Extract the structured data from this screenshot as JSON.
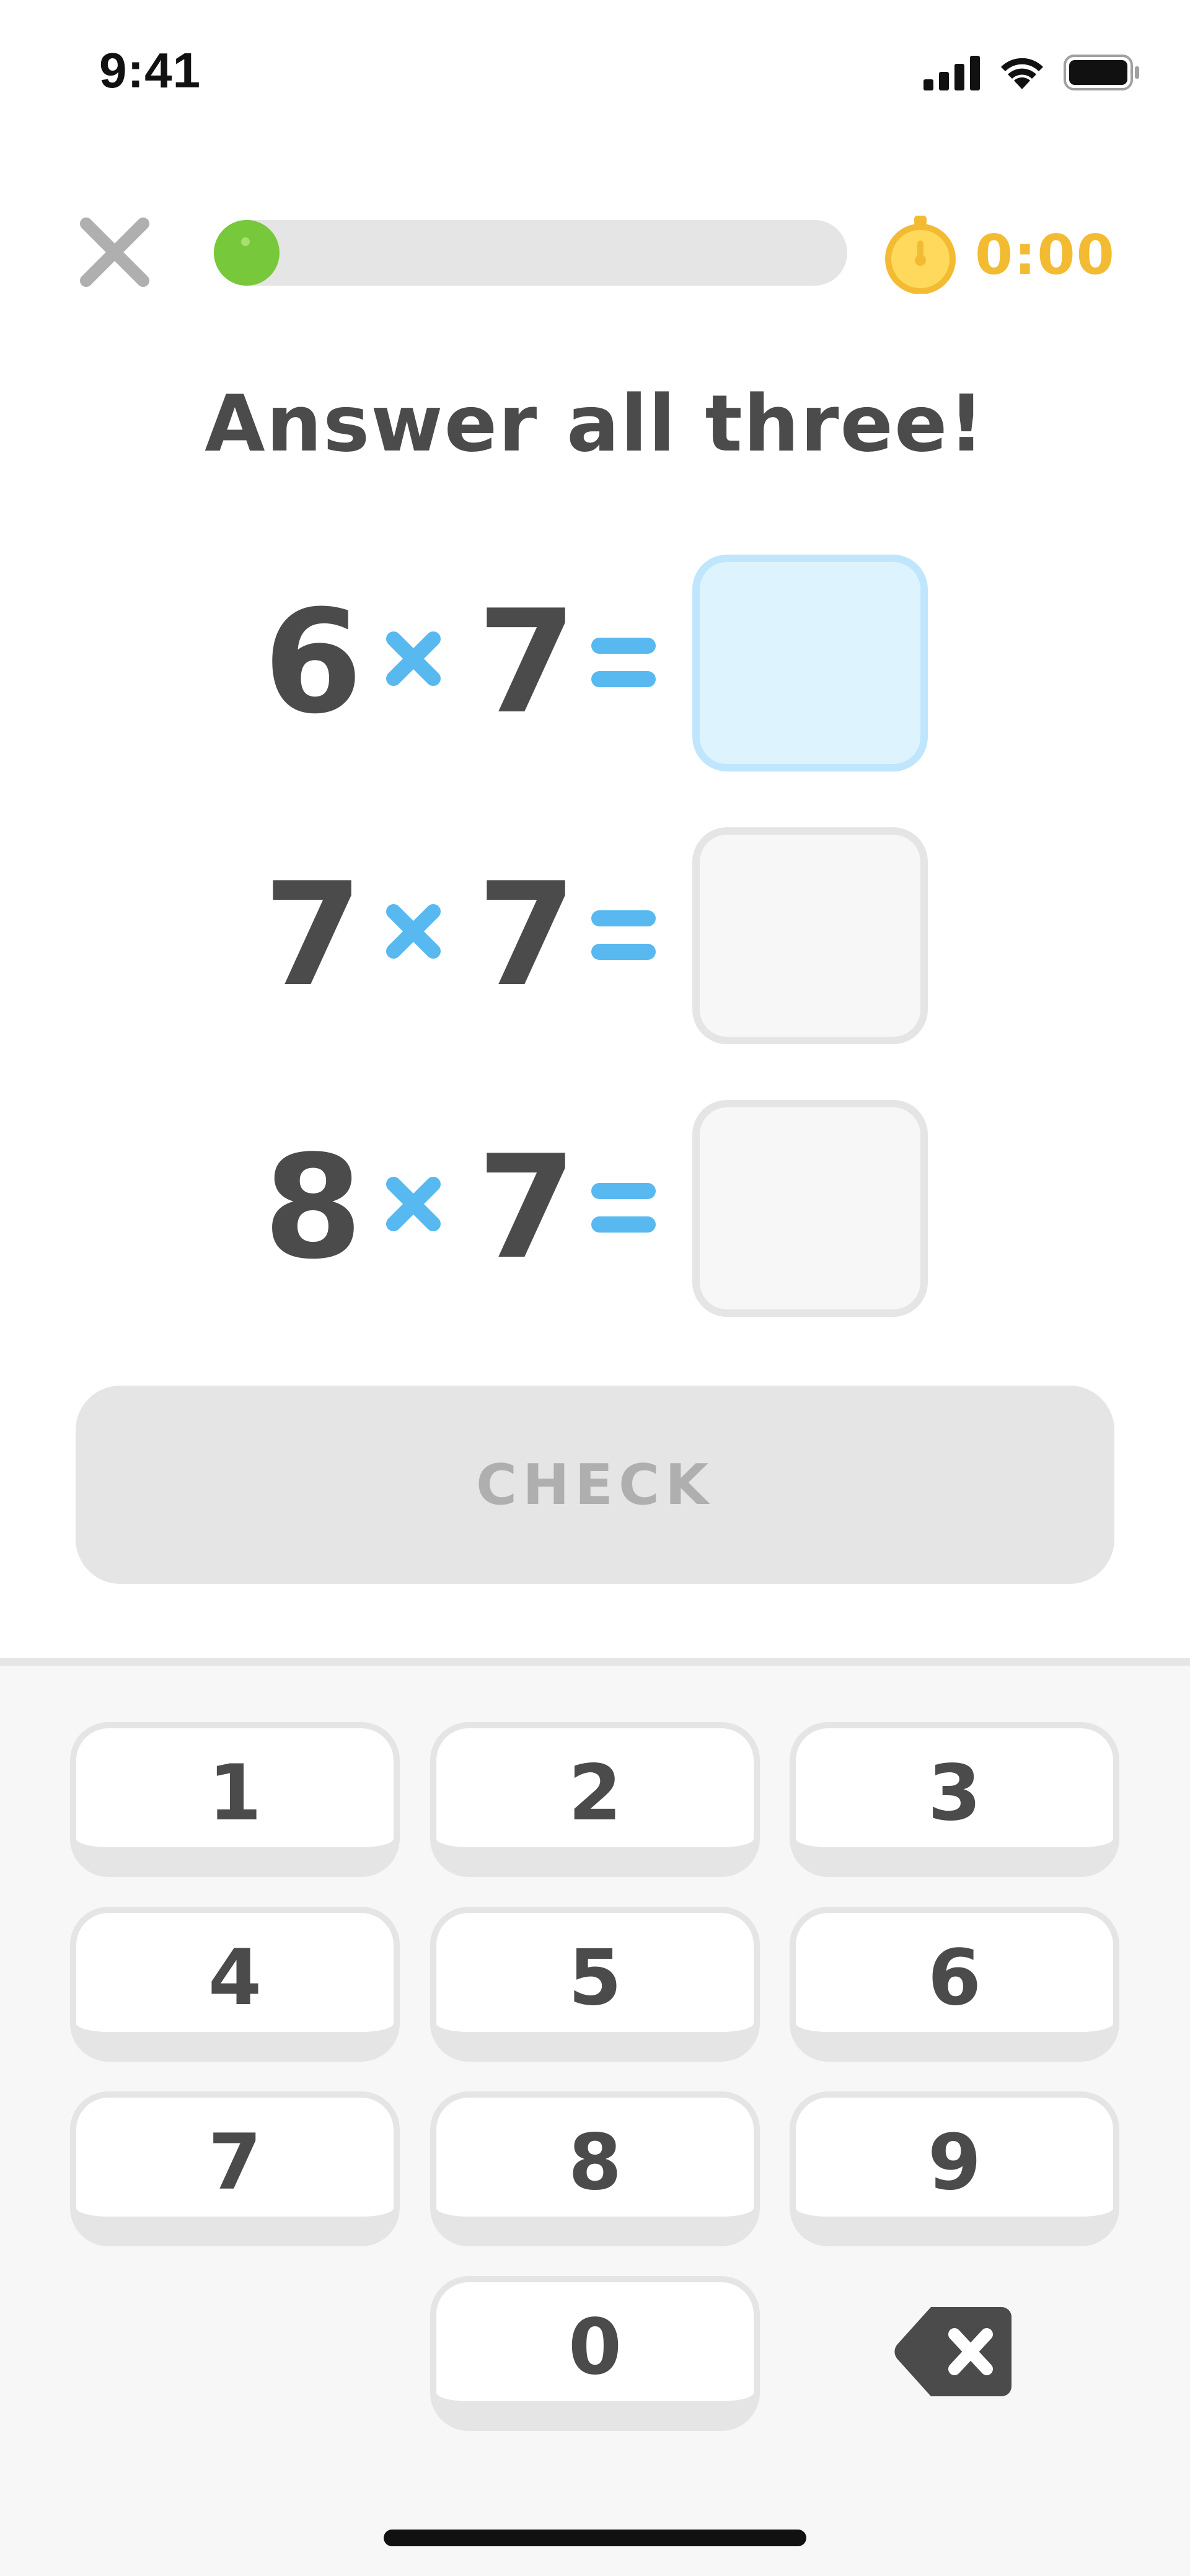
{
  "status_bar": {
    "time": "9:41",
    "icons": [
      "signal-icon",
      "wifi-icon",
      "battery-icon"
    ]
  },
  "top_bar": {
    "close_icon": "close-icon",
    "progress_percent": 0,
    "timer_icon": "stopwatch-icon",
    "timer_text": "0:00"
  },
  "title": "Answer all three!",
  "equations": [
    {
      "a": "6",
      "operator": "×",
      "b": "7",
      "equals": "=",
      "answer": "",
      "active": true
    },
    {
      "a": "7",
      "operator": "×",
      "b": "7",
      "equals": "=",
      "answer": "",
      "active": false
    },
    {
      "a": "8",
      "operator": "×",
      "b": "7",
      "equals": "=",
      "answer": "",
      "active": false
    }
  ],
  "check_button": {
    "label": "CHECK",
    "disabled": true
  },
  "keypad": {
    "keys": [
      "1",
      "2",
      "3",
      "4",
      "5",
      "6",
      "7",
      "8",
      "9",
      "0"
    ],
    "backspace_icon": "backspace-icon"
  },
  "colors": {
    "text": "#4b4b4b",
    "accent_blue": "#58b9f0",
    "progress_green": "#78c83c",
    "timer_gold": "#f3bb32",
    "disabled_gray": "#e5e5e5",
    "active_box_fill": "#ddf4ff",
    "active_box_border": "#bfe6fd"
  }
}
